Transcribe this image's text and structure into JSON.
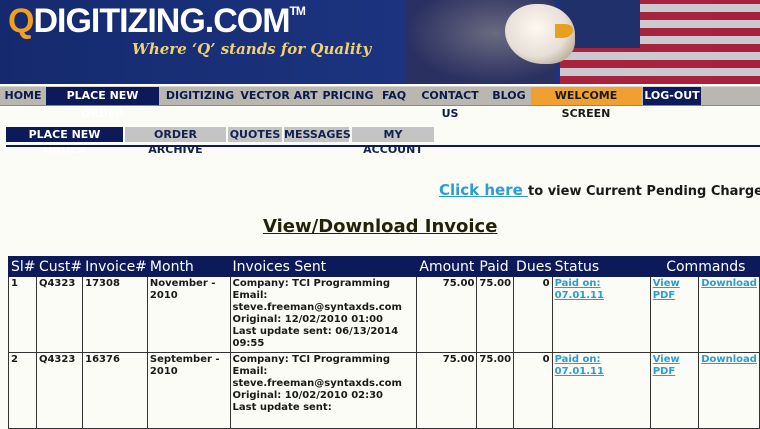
{
  "header": {
    "logo_q": "Q",
    "logo_text": "DIGITIZING.COM",
    "logo_tm": "TM",
    "tagline": "Where ‘Q’ stands for Quality"
  },
  "topnav": {
    "items": [
      {
        "label": "HOME"
      },
      {
        "label": "PLACE NEW ORDER"
      },
      {
        "label": "DIGITIZING"
      },
      {
        "label": "VECTOR ART"
      },
      {
        "label": "PRICING"
      },
      {
        "label": "FAQ"
      },
      {
        "label": "CONTACT US"
      },
      {
        "label": "BLOG"
      },
      {
        "label": "WELCOME SCREEN"
      },
      {
        "label": "LOG-OUT"
      }
    ]
  },
  "subnav": {
    "tabs": [
      {
        "label": "PLACE NEW ORDER"
      },
      {
        "label": "ORDER ARCHIVE"
      },
      {
        "label": "QUOTES"
      },
      {
        "label": "MESSAGES"
      },
      {
        "label": "MY ACCOUNT"
      }
    ]
  },
  "pending": {
    "link": "Click here ",
    "text": "to view Current Pending Charges"
  },
  "page_title": "View/Download Invoice",
  "table": {
    "headers": [
      "Sl#",
      "Cust#",
      "Invoice#",
      "Month",
      "Invoices Sent",
      "Amount",
      "Paid",
      "Dues",
      "Status",
      "Commands"
    ],
    "rows": [
      {
        "sl": "1",
        "cust": "Q4323",
        "invoice": "17308",
        "month": "November - 2010",
        "sent_company": "Company: TCI Programming",
        "sent_email_label": "Email:",
        "sent_email": "steve.freeman@syntaxds.com",
        "sent_original": "Original: 12/02/2010 01:00",
        "sent_update": "Last update sent: 06/13/2014 09:55",
        "amount": "75.00",
        "paid": "75.00",
        "dues": "0",
        "status": "Paid on: 07.01.11",
        "view": "View PDF",
        "download": "Download"
      },
      {
        "sl": "2",
        "cust": "Q4323",
        "invoice": "16376",
        "month": "September - 2010",
        "sent_company": "Company: TCI Programming",
        "sent_email_label": "Email:",
        "sent_email": "steve.freeman@syntaxds.com",
        "sent_original": "Original: 10/02/2010 02:30",
        "sent_update": "Last update sent:",
        "amount": "75.00",
        "paid": "75.00",
        "dues": "0",
        "status": "Paid on: 07.01.11",
        "view": "View PDF",
        "download": "Download"
      }
    ]
  },
  "colors": {
    "nav_dark": "#0c1a5a",
    "nav_gray": "#b9b7af",
    "link_blue": "#2b9cd6",
    "welcome_orange": "#f0a030",
    "logo_orange": "#f0a020"
  }
}
